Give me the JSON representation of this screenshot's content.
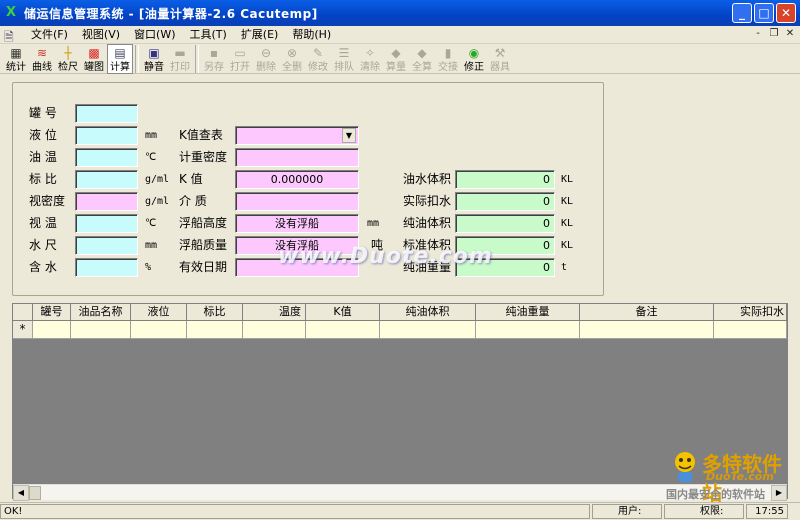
{
  "window": {
    "title": "储运信息管理系统 - [油量计算器-2.6 Cacutemp]",
    "minimize": "_",
    "maximize": "□",
    "close": "✕"
  },
  "menu": {
    "items": [
      "文件(F)",
      "视图(V)",
      "窗口(W)",
      "工具(T)",
      "扩展(E)",
      "帮助(H)"
    ],
    "mdi_min": "-",
    "mdi_restore": "❐",
    "mdi_close": "✕"
  },
  "toolbar": {
    "buttons": [
      {
        "label": "统计",
        "icon": "chart-grid-icon",
        "enabled": true
      },
      {
        "label": "曲线",
        "icon": "curve-icon",
        "enabled": true
      },
      {
        "label": "检尺",
        "icon": "ruler-icon",
        "enabled": true
      },
      {
        "label": "罐图",
        "icon": "tank-icon",
        "enabled": true
      },
      {
        "label": "计算",
        "icon": "calculator-icon",
        "enabled": true,
        "pressed": true
      },
      {
        "label": "静音",
        "icon": "mute-icon",
        "enabled": true
      },
      {
        "label": "打印",
        "icon": "print-icon",
        "enabled": false
      },
      {
        "label": "另存",
        "icon": "save-as-icon",
        "enabled": false
      },
      {
        "label": "打开",
        "icon": "open-icon",
        "enabled": false
      },
      {
        "label": "删除",
        "icon": "delete-icon",
        "enabled": false
      },
      {
        "label": "全删",
        "icon": "delete-all-icon",
        "enabled": false
      },
      {
        "label": "修改",
        "icon": "edit-icon",
        "enabled": false
      },
      {
        "label": "排队",
        "icon": "queue-icon",
        "enabled": false
      },
      {
        "label": "清除",
        "icon": "clear-icon",
        "enabled": false
      },
      {
        "label": "算量",
        "icon": "compute-icon",
        "enabled": false
      },
      {
        "label": "全算",
        "icon": "compute-all-icon",
        "enabled": false
      },
      {
        "label": "交接",
        "icon": "handover-icon",
        "enabled": false
      },
      {
        "label": "修正",
        "icon": "correct-icon",
        "enabled": true
      },
      {
        "label": "器具",
        "icon": "tools-icon",
        "enabled": false
      }
    ]
  },
  "form": {
    "left": {
      "tank_no": {
        "label": "罐  号",
        "value": ""
      },
      "level": {
        "label": "液  位",
        "value": "",
        "unit": "mm"
      },
      "oil_temp": {
        "label": "油  温",
        "value": "",
        "unit": "℃"
      },
      "std_density": {
        "label": "标  比",
        "value": "",
        "unit": "g/ml"
      },
      "apparent_density": {
        "label": "视密度",
        "value": "",
        "unit": "g/ml"
      },
      "apparent_temp": {
        "label": "视  温",
        "value": "",
        "unit": "℃"
      },
      "water_level": {
        "label": "水  尺",
        "value": "",
        "unit": "mm"
      },
      "water_content": {
        "label": "含  水",
        "value": "",
        "unit": "%"
      }
    },
    "middle": {
      "k_table": {
        "label": "K值查表",
        "value": ""
      },
      "weight_density": {
        "label": "计重密度",
        "value": ""
      },
      "k_value": {
        "label": "K  值",
        "value": "0.000000"
      },
      "medium": {
        "label": "介  质",
        "value": ""
      },
      "float_height": {
        "label": "浮船高度",
        "value": "没有浮船",
        "unit": "mm"
      },
      "float_mass": {
        "label": "浮船质量",
        "value": "没有浮船",
        "unit": "吨"
      },
      "valid_date": {
        "label": "有效日期",
        "value": ""
      }
    },
    "right": {
      "oil_water_vol": {
        "label": "油水体积",
        "value": "0",
        "unit": "KL"
      },
      "actual_deduct": {
        "label": "实际扣水",
        "value": "0",
        "unit": "KL"
      },
      "pure_oil_vol": {
        "label": "纯油体积",
        "value": "0",
        "unit": "KL"
      },
      "std_vol": {
        "label": "标准体积",
        "value": "0",
        "unit": "KL"
      },
      "pure_oil_weight": {
        "label": "纯油重量",
        "value": "0",
        "unit": "t"
      }
    }
  },
  "grid": {
    "columns": [
      "",
      "罐号",
      "油品名称",
      "液位",
      "标比",
      "温度",
      "K值",
      "纯油体积",
      "纯油重量",
      "备注",
      "实际扣水"
    ],
    "new_row_marker": "*"
  },
  "watermark": "www.Duote.com",
  "logo": {
    "brand": "多特软件站",
    "domain": "DuoTe.com",
    "tagline": "国内最安全的软件站"
  },
  "status": {
    "left": "OK!",
    "user_label": "用户:",
    "user": "",
    "perm_label": "权限:",
    "perm": "",
    "time": "17:55"
  }
}
